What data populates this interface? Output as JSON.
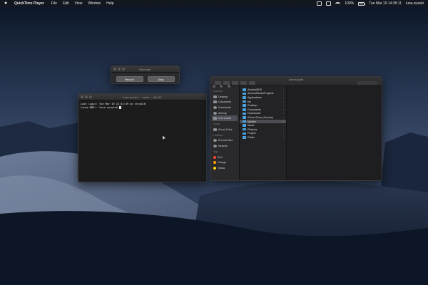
{
  "menubar": {
    "app_name": "QuickTime Player",
    "menus": [
      "File",
      "Edit",
      "View",
      "Window",
      "Help"
    ],
    "battery": "100%",
    "clock": "Tue Mar 19  14:35:11",
    "user": "luna.suzuki"
  },
  "recorder": {
    "title": "Recorder",
    "record_label": "Record",
    "stop_label": "Stop"
  },
  "terminal": {
    "title": "luna.suzuki — -bash — 80×24",
    "lines": [
      "Last login: Tue Mar 19 14:31:49 on ttys010",
      "Lunas-MBP:~ luna.suzuki$ "
    ]
  },
  "finder": {
    "title": "luna.suzuki",
    "sidebar": {
      "favorites_header": "Favorites",
      "favorites": [
        "Desktop",
        "Documents",
        "Downloads",
        "AirDrop",
        "luna.suzuki"
      ],
      "icloud_header": "iCloud",
      "icloud": [
        "iCloud Drive"
      ],
      "locations_header": "Locations",
      "locations": [
        "Remote Disc",
        "Network"
      ],
      "tags_header": "Tags",
      "tags": [
        {
          "label": "Red",
          "color": "#ff453a"
        },
        {
          "label": "Orange",
          "color": "#ff9f0a"
        },
        {
          "label": "Yellow",
          "color": "#ffd60a"
        }
      ]
    },
    "items": [
      "AndroidSDK",
      "AndroidStudioProjects",
      "Applications",
      "bin",
      "Desktop",
      "Documents",
      "Downloads",
      "iCloud Drive (Archive)",
      "Movies",
      "Music",
      "Pictures",
      "Project",
      "Public"
    ],
    "selected_item": "Movies",
    "arrow_glyph": "›"
  }
}
